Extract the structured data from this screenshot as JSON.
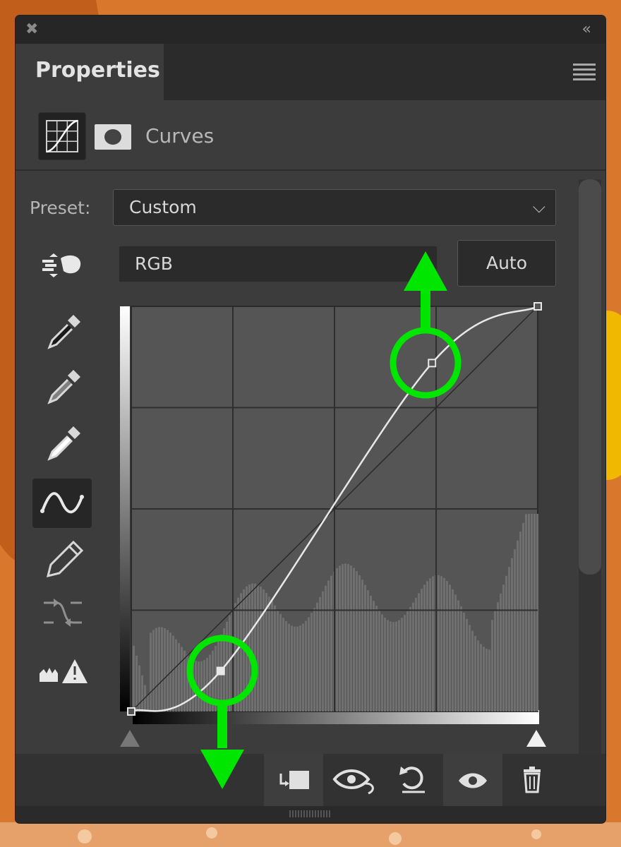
{
  "panel": {
    "close_label": "✖",
    "collapse_label": "«",
    "tab_title": "Properties"
  },
  "header": {
    "title": "Curves",
    "curves_icon": "curves-grid-icon",
    "mask_icon": "layer-mask-icon"
  },
  "preset": {
    "label": "Preset:",
    "value": "Custom"
  },
  "channel": {
    "value": "RGB"
  },
  "auto_button": "Auto",
  "tools": [
    {
      "name": "targeted-adjustment-icon"
    },
    {
      "name": "black-point-eyedropper-icon"
    },
    {
      "name": "gray-point-eyedropper-icon"
    },
    {
      "name": "white-point-eyedropper-icon"
    },
    {
      "name": "curve-points-icon",
      "selected": true
    },
    {
      "name": "pencil-icon"
    },
    {
      "name": "smooth-curve-icon"
    },
    {
      "name": "clipping-warning-icon"
    }
  ],
  "curve_points": [
    [
      0,
      0
    ],
    [
      0.22,
      0.1
    ],
    [
      0.74,
      0.86
    ],
    [
      1,
      1
    ]
  ],
  "bottom_buttons": [
    {
      "name": "clip-to-layer-icon"
    },
    {
      "name": "view-previous-state-icon"
    },
    {
      "name": "reset-icon"
    },
    {
      "name": "visibility-eye-icon"
    },
    {
      "name": "delete-icon"
    }
  ],
  "annotation_color": "#00e600"
}
